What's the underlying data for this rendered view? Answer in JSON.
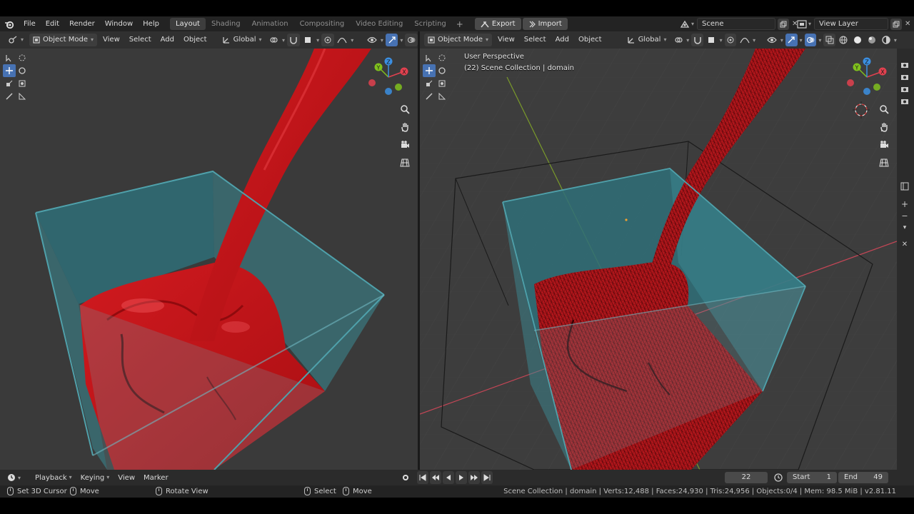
{
  "topbar": {
    "menus": [
      "File",
      "Edit",
      "Render",
      "Window",
      "Help"
    ],
    "workspaces": [
      "Layout",
      "Shading",
      "Animation",
      "Compositing",
      "Video Editing",
      "Scripting"
    ],
    "active_workspace": "Layout",
    "add_workspace": "+",
    "addon_buttons": [
      "Export",
      "Import"
    ],
    "scene": "Scene",
    "view_layer": "View Layer"
  },
  "left_header": {
    "mode": "Object Mode",
    "menus": [
      "View",
      "Select",
      "Add",
      "Object"
    ],
    "orientation": "Global"
  },
  "right_header": {
    "mode": "Object Mode",
    "menus": [
      "View",
      "Select",
      "Add",
      "Object"
    ],
    "orientation": "Global"
  },
  "right_viewport": {
    "view_name": "User Perspective",
    "collection_info": "(22) Scene Collection | domain"
  },
  "gizmo": {
    "axes": [
      "X",
      "Y",
      "Z"
    ],
    "colors": {
      "x": "#e2414f",
      "y": "#80c11d",
      "z": "#3b8fe2"
    }
  },
  "timeline": {
    "menus": [
      "Playback",
      "Keying",
      "View",
      "Marker"
    ],
    "current_frame": "22",
    "start_label": "Start",
    "start_value": "1",
    "end_label": "End",
    "end_value": "49"
  },
  "statusbar": {
    "left_items": [
      "Set 3D Cursor",
      "Move",
      "Rotate View",
      "Select",
      "Move"
    ],
    "stats": "Scene Collection | domain | Verts:12,488 | Faces:24,930 | Tris:24,956 | Objects:0/4 | Mem: 98.5 MiB | v2.81.11"
  },
  "colors": {
    "accent": "#4772b3",
    "liquid": "#c4161c",
    "domain_box": "#3b8a94"
  }
}
